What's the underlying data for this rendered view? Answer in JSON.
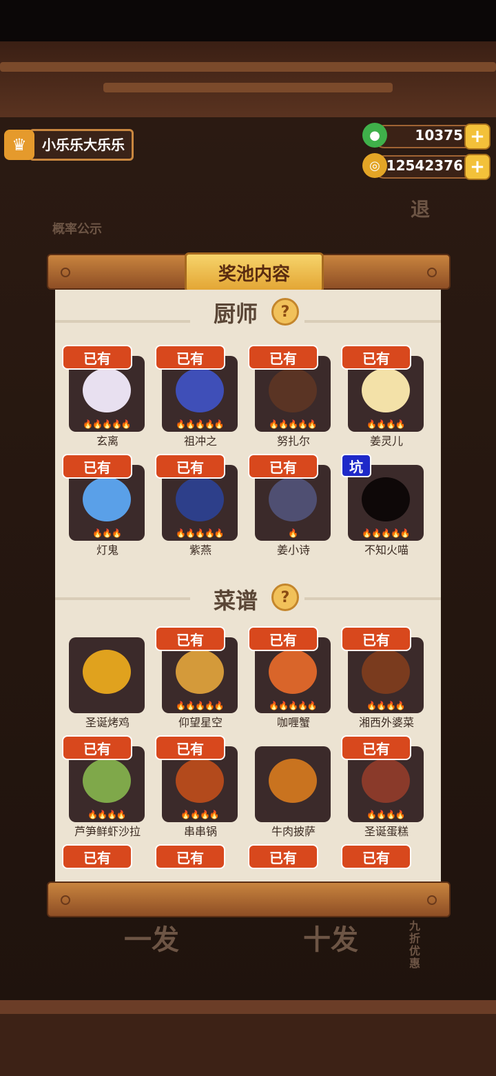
{
  "player": {
    "name": "小乐乐大乐乐"
  },
  "currency": {
    "jade": "10375",
    "coins": "12542376"
  },
  "background_buttons": {
    "odds": "概率公示",
    "exit": "退",
    "single_pull": "一发",
    "ten_pull": "十发",
    "discount": "九折优惠"
  },
  "panel": {
    "title": "奖池内容",
    "chefs_section": "厨师",
    "recipes_section": "菜谱",
    "chefs": [
      {
        "name": "玄离",
        "badge": "已有",
        "stars": "🔥🔥🔥🔥🔥",
        "color": "#e8e0f0"
      },
      {
        "name": "祖冲之",
        "badge": "已有",
        "stars": "🔥🔥🔥🔥🔥",
        "color": "#3f4fb8"
      },
      {
        "name": "努扎尔",
        "badge": "已有",
        "stars": "🔥🔥🔥🔥🔥",
        "color": "#5a3424"
      },
      {
        "name": "姜灵儿",
        "badge": "已有",
        "stars": "🔥🔥🔥🔥",
        "color": "#f3e1a8"
      },
      {
        "name": "灯鬼",
        "badge": "已有",
        "stars": "🔥🔥🔥",
        "color": "#5aa0e8"
      },
      {
        "name": "紫燕",
        "badge": "已有",
        "stars": "🔥🔥🔥🔥🔥",
        "color": "#2d3f8a"
      },
      {
        "name": "姜小诗",
        "badge": "已有",
        "stars": "🔥",
        "color": "#4f4f72"
      },
      {
        "name": "不知火喵",
        "badge": "坑",
        "stars": "🔥🔥🔥🔥🔥",
        "color": "#0e0808"
      }
    ],
    "recipes": [
      {
        "name": "圣诞烤鸡",
        "badge": "",
        "stars": "",
        "color": "#e0a21e"
      },
      {
        "name": "仰望星空",
        "badge": "已有",
        "stars": "🔥🔥🔥🔥🔥",
        "color": "#d49a3a"
      },
      {
        "name": "咖喱蟹",
        "badge": "已有",
        "stars": "🔥🔥🔥🔥🔥",
        "color": "#d9652a"
      },
      {
        "name": "湘西外婆菜",
        "badge": "已有",
        "stars": "🔥🔥🔥🔥",
        "color": "#7a3b1e"
      },
      {
        "name": "芦笋鲜虾沙拉",
        "badge": "已有",
        "stars": "🔥🔥🔥🔥",
        "color": "#7fa84a"
      },
      {
        "name": "串串锅",
        "badge": "已有",
        "stars": "🔥🔥🔥🔥",
        "color": "#b34a1c"
      },
      {
        "name": "牛肉披萨",
        "badge": "",
        "stars": "",
        "color": "#c9731f"
      },
      {
        "name": "圣诞蛋糕",
        "badge": "已有",
        "stars": "🔥🔥🔥🔥",
        "color": "#8a3a2a"
      }
    ],
    "partial_row_badges": [
      "已有",
      "已有",
      "已有",
      "已有"
    ]
  },
  "colors": {
    "owned_badge": "#d8481d",
    "pit_badge": "#1e29c9",
    "paper": "#ece3d2"
  }
}
